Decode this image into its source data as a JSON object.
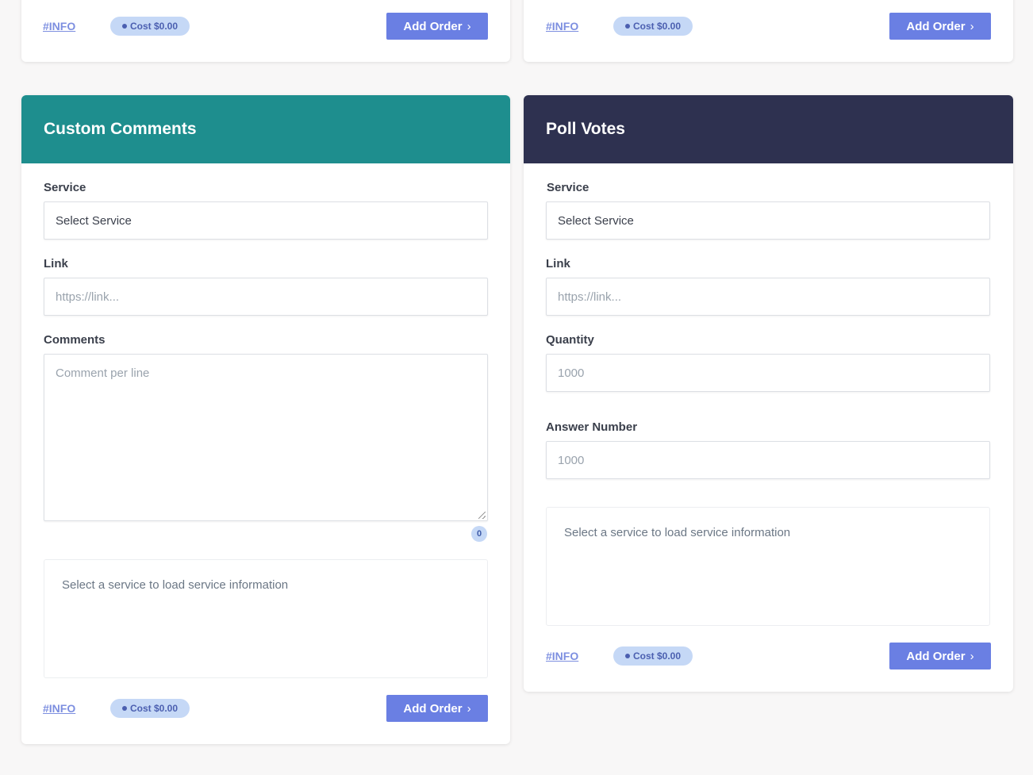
{
  "common": {
    "info_link": "#INFO",
    "cost": "Cost $0.00",
    "add_order": "Add Order",
    "chevron_glyph": "›",
    "info_text": "Select a service to load service information",
    "accent_button": "#6a7fe3"
  },
  "custom_comments": {
    "title": "Custom Comments",
    "header_color": "#1e8e8e",
    "service_label": "Service",
    "service_value": "Select Service",
    "link_label": "Link",
    "link_placeholder": "https://link...",
    "comments_label": "Comments",
    "comments_placeholder": "Comment per line",
    "comment_count": "0"
  },
  "poll_votes": {
    "title": "Poll Votes",
    "header_color": "#2e3150",
    "service_label": "Service",
    "service_value": "Select Service",
    "link_label": "Link",
    "link_placeholder": "https://link...",
    "quantity_label": "Quantity",
    "quantity_placeholder": "1000",
    "answer_label": "Answer Number",
    "answer_placeholder": "1000"
  }
}
